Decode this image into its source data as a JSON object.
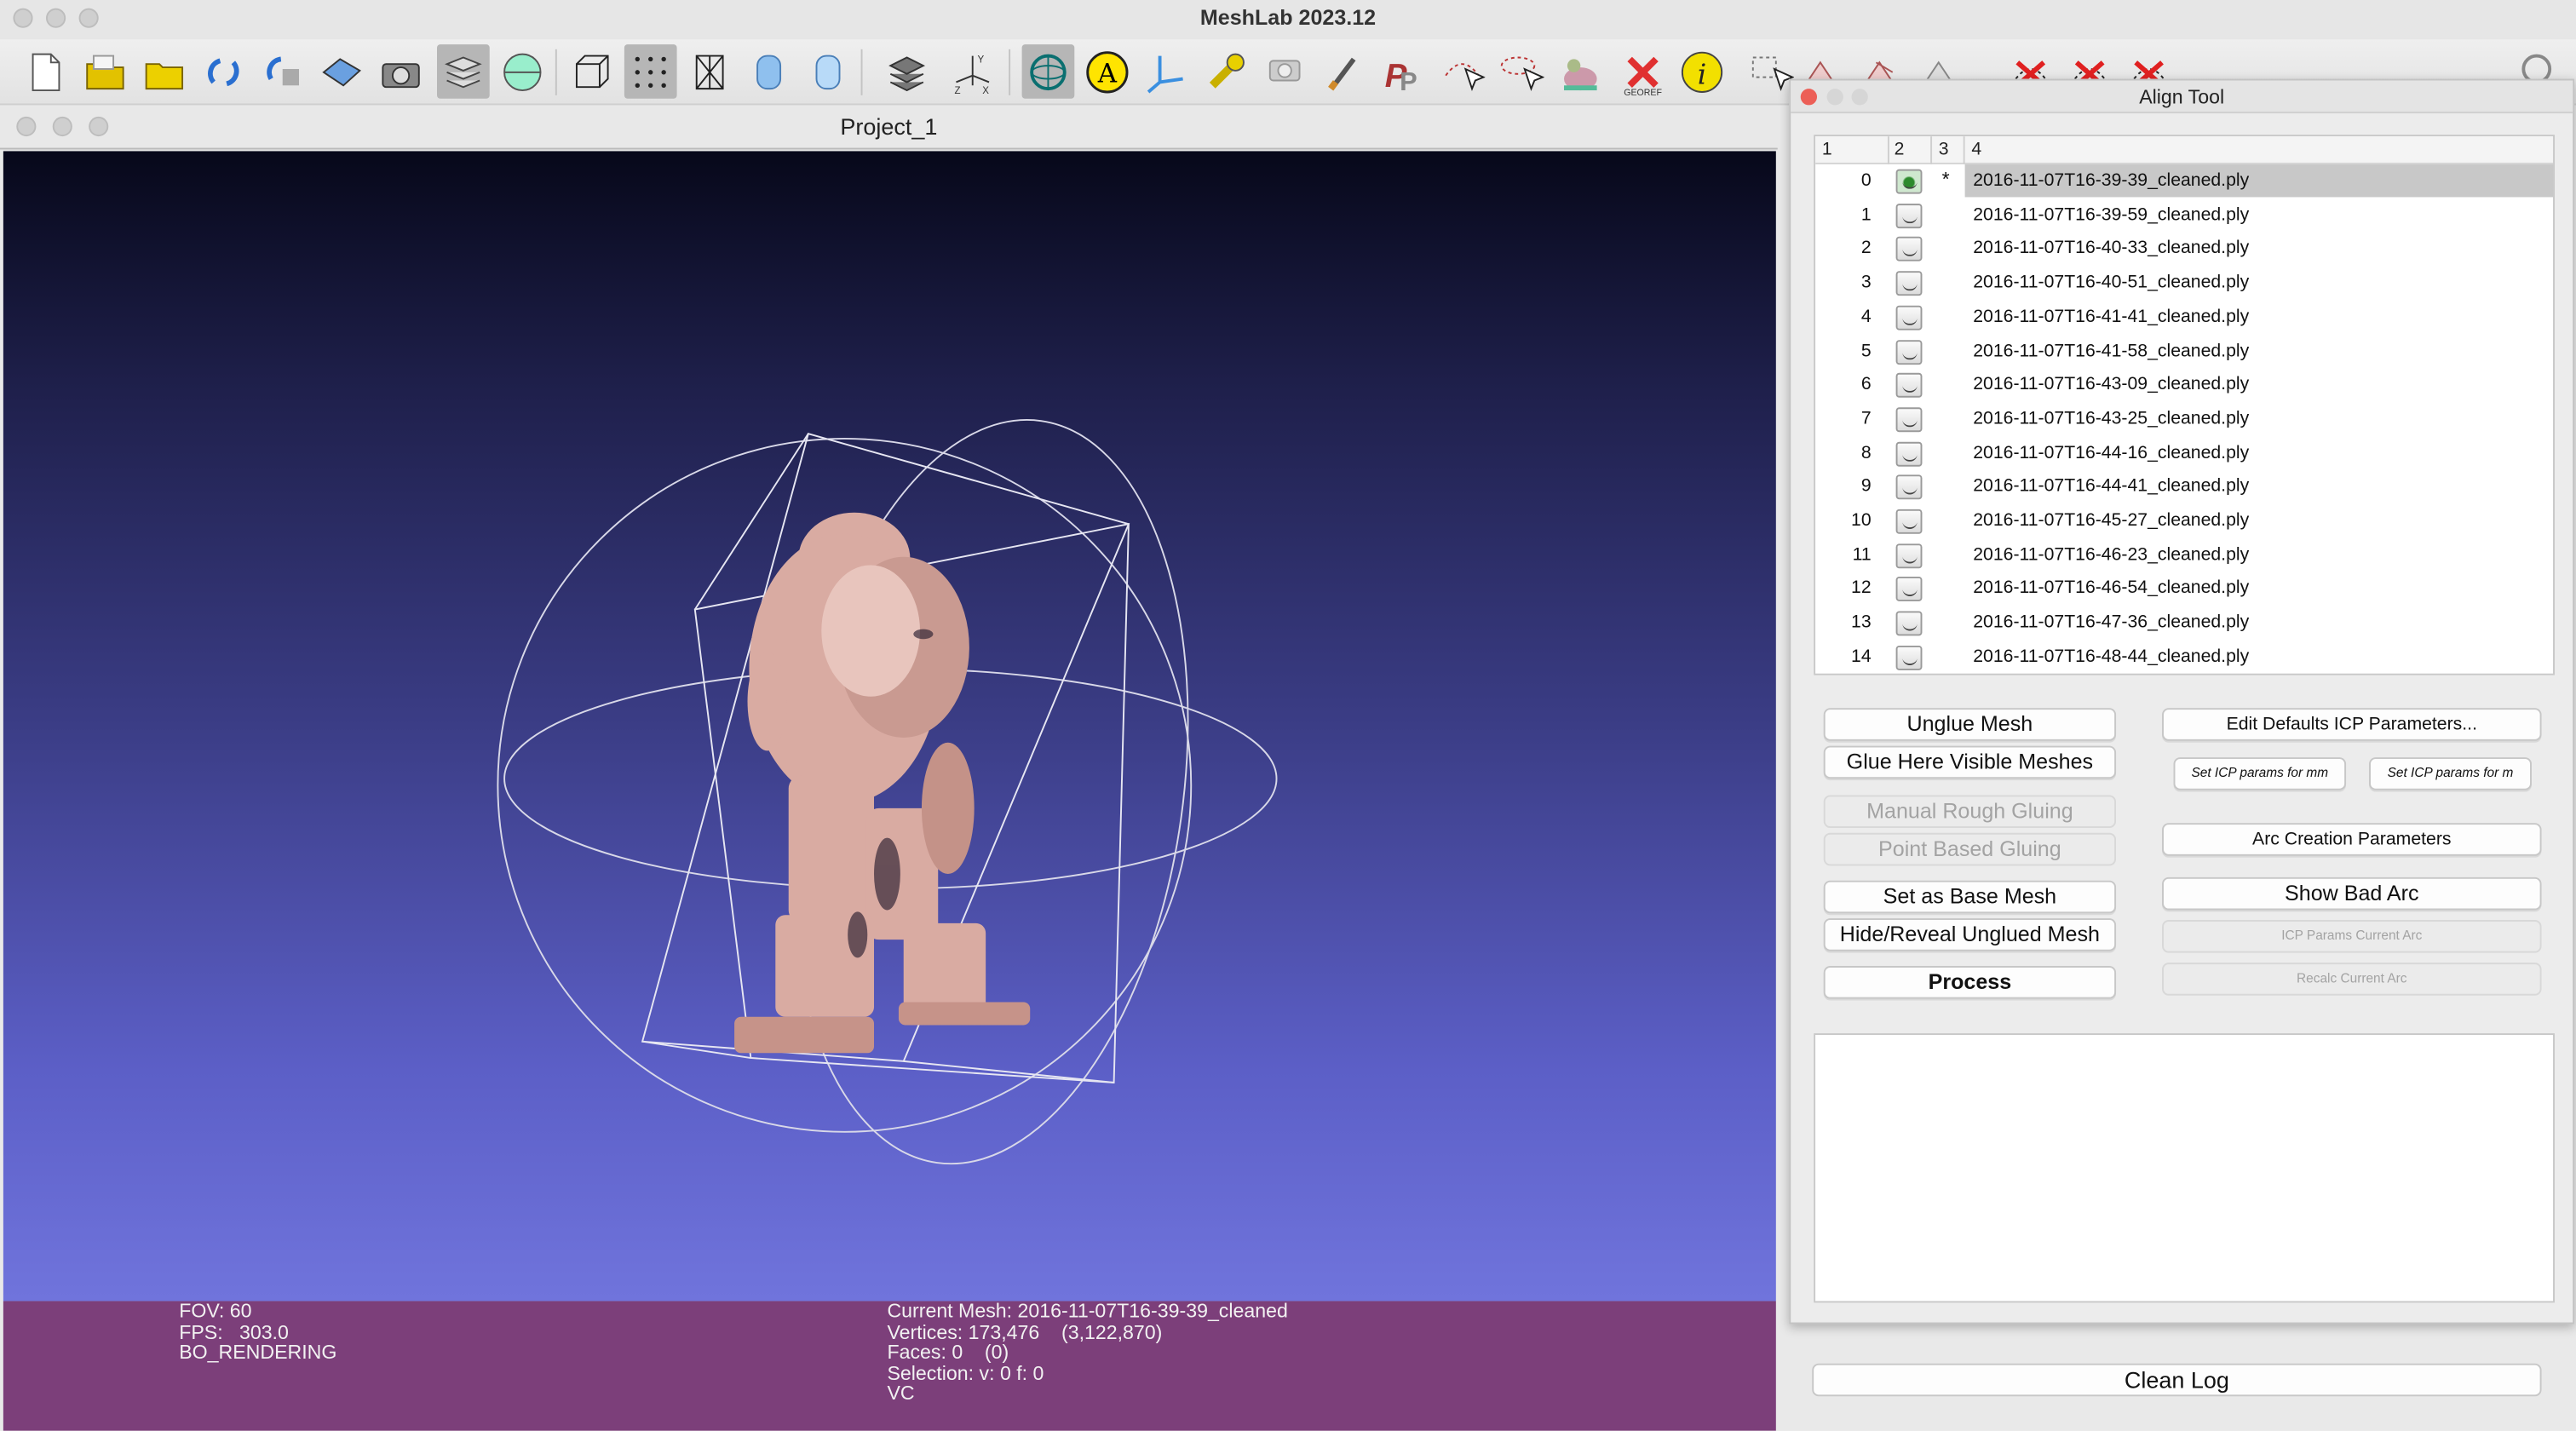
{
  "app": {
    "title": "MeshLab 2023.12"
  },
  "toolbar": {
    "georef_label": "GEOREF",
    "raster_label": "Raster Alignment"
  },
  "project": {
    "title": "Project_1"
  },
  "info": {
    "left": [
      "FOV: 60",
      "FPS:   303.0",
      "BO_RENDERING"
    ],
    "right": [
      "Current Mesh: 2016-11-07T16-39-39_cleaned",
      "Vertices: 173,476    (3,122,870)",
      "Faces: 0    (0)",
      "Selection: v: 0 f: 0",
      "VC"
    ]
  },
  "align": {
    "title": "Align Tool",
    "columns": [
      "1",
      "2",
      "3",
      "4"
    ],
    "rows": [
      {
        "idx": "0",
        "star": "*",
        "name": "2016-11-07T16-39-39_cleaned.ply",
        "selected": true
      },
      {
        "idx": "1",
        "star": "",
        "name": "2016-11-07T16-39-59_cleaned.ply"
      },
      {
        "idx": "2",
        "star": "",
        "name": "2016-11-07T16-40-33_cleaned.ply"
      },
      {
        "idx": "3",
        "star": "",
        "name": "2016-11-07T16-40-51_cleaned.ply"
      },
      {
        "idx": "4",
        "star": "",
        "name": "2016-11-07T16-41-41_cleaned.ply"
      },
      {
        "idx": "5",
        "star": "",
        "name": "2016-11-07T16-41-58_cleaned.ply"
      },
      {
        "idx": "6",
        "star": "",
        "name": "2016-11-07T16-43-09_cleaned.ply"
      },
      {
        "idx": "7",
        "star": "",
        "name": "2016-11-07T16-43-25_cleaned.ply"
      },
      {
        "idx": "8",
        "star": "",
        "name": "2016-11-07T16-44-16_cleaned.ply"
      },
      {
        "idx": "9",
        "star": "",
        "name": "2016-11-07T16-44-41_cleaned.ply"
      },
      {
        "idx": "10",
        "star": "",
        "name": "2016-11-07T16-45-27_cleaned.ply"
      },
      {
        "idx": "11",
        "star": "",
        "name": "2016-11-07T16-46-23_cleaned.ply"
      },
      {
        "idx": "12",
        "star": "",
        "name": "2016-11-07T16-46-54_cleaned.ply"
      },
      {
        "idx": "13",
        "star": "",
        "name": "2016-11-07T16-47-36_cleaned.ply"
      },
      {
        "idx": "14",
        "star": "",
        "name": "2016-11-07T16-48-44_cleaned.ply"
      }
    ],
    "buttons": {
      "unglue": "Unglue Mesh",
      "glue_visible": "Glue Here Visible Meshes",
      "manual_rough": "Manual Rough Gluing",
      "point_based": "Point Based Gluing",
      "set_base": "Set as Base Mesh",
      "hide_reveal": "Hide/Reveal Unglued Mesh",
      "process": "Process",
      "edit_defaults": "Edit Defaults ICP Parameters...",
      "set_icp_mm": "Set ICP params for mm",
      "set_icp_m": "Set ICP params for m",
      "arc_creation": "Arc Creation Parameters",
      "show_bad_arc": "Show Bad Arc",
      "icp_current_arc": "ICP Params Current Arc",
      "recalc_arc": "Recalc Current Arc"
    },
    "clean_log": "Clean Log"
  }
}
